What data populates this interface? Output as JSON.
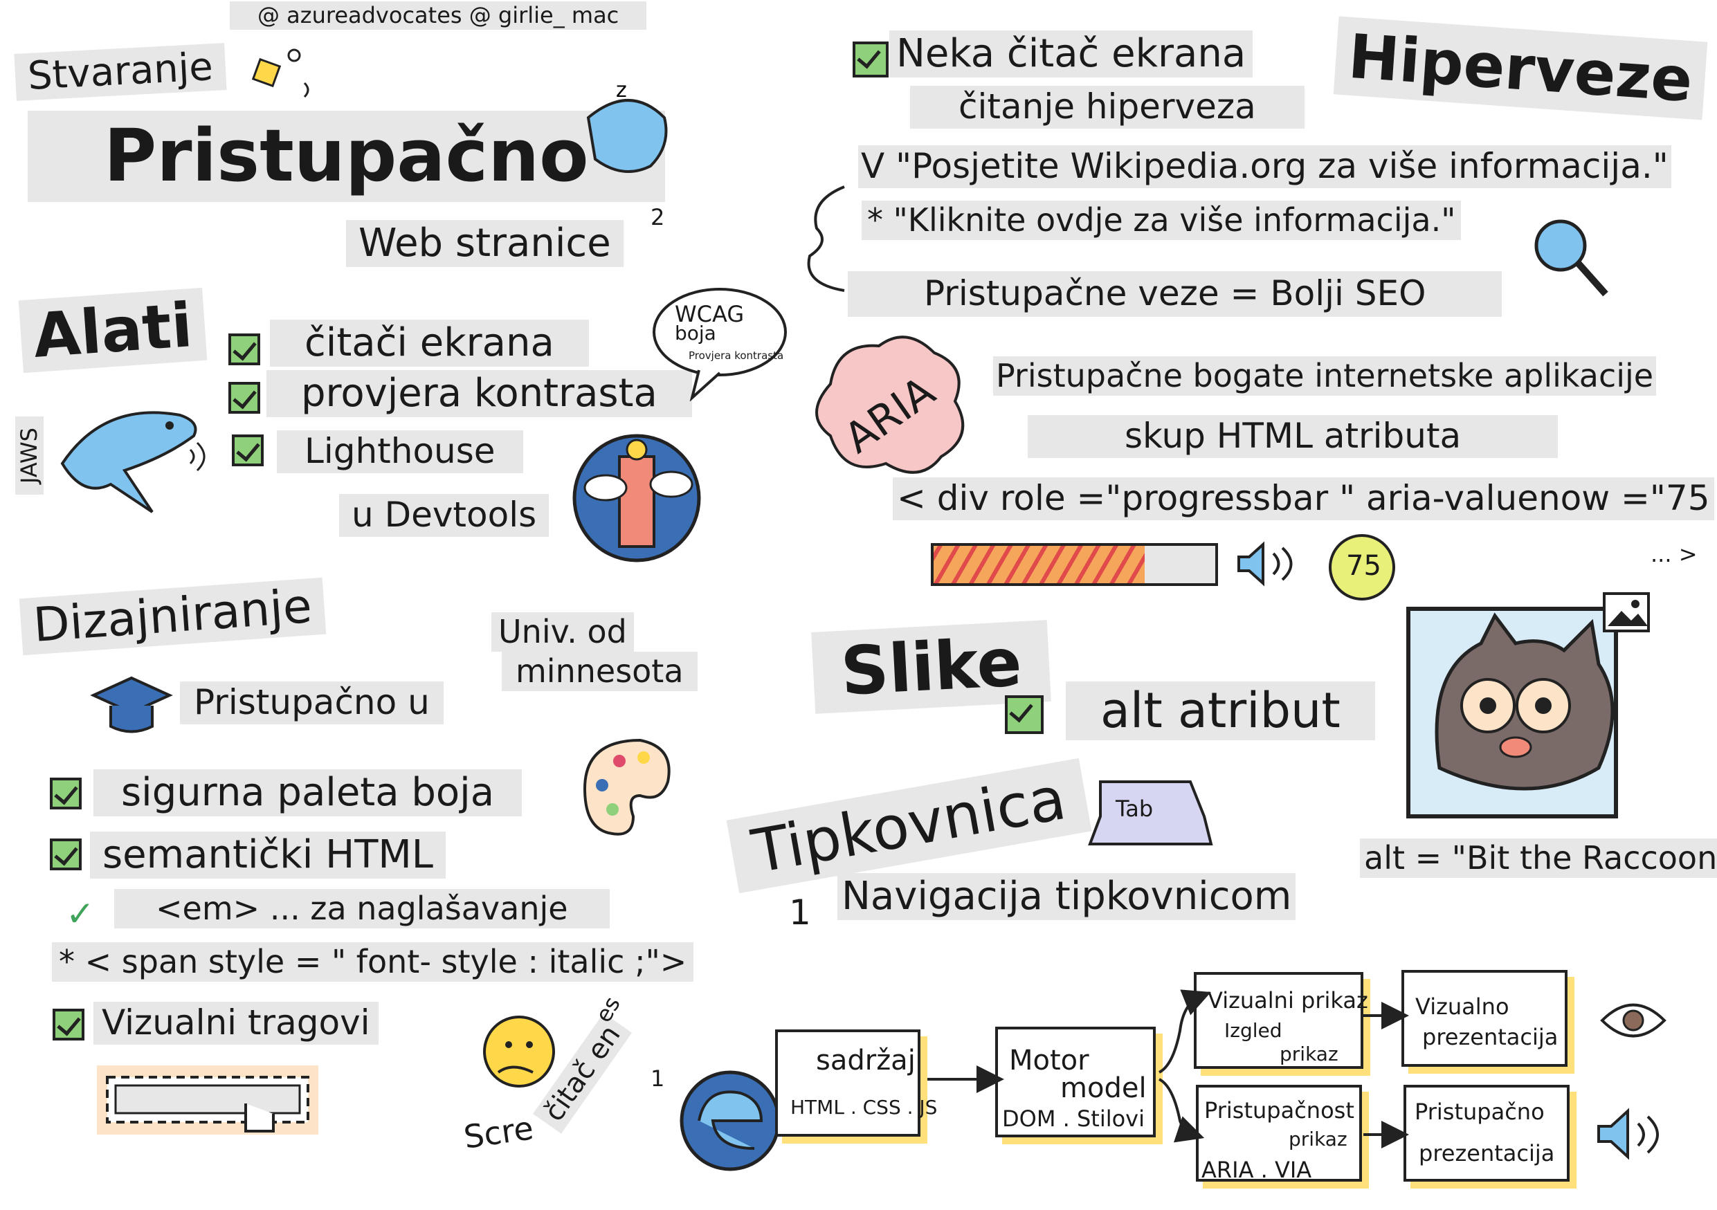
{
  "credits": "@ azureadvocates @ girlie_ mac",
  "title": {
    "line1": "Stvaranje",
    "line2": "Pristupačno",
    "line3": "Web stranice"
  },
  "tools": {
    "heading": "Alati",
    "items": [
      "čitači ekrana",
      "provjera kontrasta",
      "Lighthouse"
    ],
    "devtools": "u Devtools",
    "jaws": "JAWS",
    "wcag_bubble": {
      "line1": "WCAG",
      "line2": "boja",
      "line3": "Provjera kontrasta"
    }
  },
  "design": {
    "heading": "Dizajniranje",
    "univ_line1": "Univ. od",
    "univ_line2": "minnesota",
    "accessible_in": "Pristupačno u",
    "items": [
      "sigurna paleta boja",
      "semantički HTML",
      "<em> ... za naglašavanje",
      "* < span style = \" font- style : italic ;\">",
      "Vizualni tragovi"
    ],
    "screen_reader": "Scre",
    "screen_reader_rot": "čitač en",
    "es": "es"
  },
  "hyperlinks": {
    "heading": "Hiperveze",
    "note_line1": "Neka čitač ekrana",
    "note_line2": "čitanje hiperveza",
    "good": "V \"Posjetite Wikipedia.org za više informacija.\"",
    "bad": "* \"Kliknite ovdje za više informacija.\"",
    "seo": "Pristupačne veze = Bolji SEO"
  },
  "aria": {
    "badge": "ARIA",
    "line1": "Pristupačne bogate internetske aplikacije",
    "line2": "skup HTML atributa",
    "code": "< div role =\"progressbar \" aria-valuenow =\"75",
    "code_end": "... >",
    "progress_value": 75,
    "progress_label": "75"
  },
  "images": {
    "heading": "Slike",
    "alt_attr": "alt atribut",
    "alt_example": "alt = \"Bit the Raccoon\""
  },
  "keyboard": {
    "heading": "Tipkovnica",
    "tab_key": "Tab",
    "nav_num": "1",
    "nav": "Navigacija tipkovnicom"
  },
  "pipeline": {
    "num": "1",
    "content": {
      "title": "sadržaj",
      "sub": "HTML . CSS . JS"
    },
    "engine": {
      "l1": "Motor",
      "l2": "model",
      "l3": "DOM . Stilovi"
    },
    "visual_view": {
      "l1": "Vizualni prikaz",
      "l2": "Izgled",
      "l3": "prikaz"
    },
    "a11y_view": {
      "l1": "Pristupačnost",
      "l2": "prikaz",
      "l3": "ARIA . VIA"
    },
    "visual_pres": {
      "l1": "Vizualno",
      "l2": "prezentacija"
    },
    "a11y_pres": {
      "l1": "Pristupačno",
      "l2": "prezentacija"
    }
  },
  "colors": {
    "label_bg": "#e7e7e7",
    "check_green": "#8fd17a",
    "aria_pink": "#f7c6c6",
    "progress_orange": "#f6a65a",
    "highlight_yellow": "#ffe07a",
    "shark_blue": "#7fc3ee"
  },
  "icons": [
    "shark-icon",
    "lighthouse-icon",
    "graduation-cap-icon",
    "palette-icon",
    "magnifier-icon",
    "speaker-icon",
    "raccoon-icon",
    "image-icon",
    "tab-key-icon",
    "edge-logo-icon",
    "eye-icon",
    "thinking-face-icon",
    "pointer-hand-icon"
  ]
}
